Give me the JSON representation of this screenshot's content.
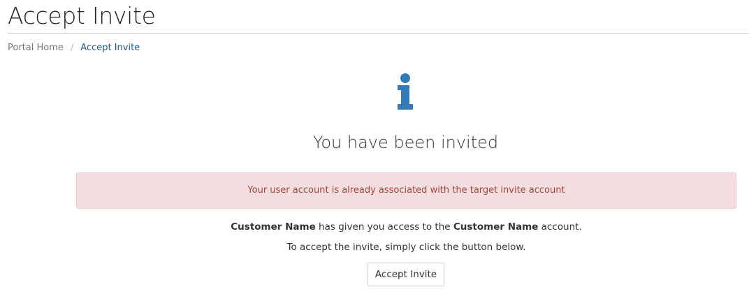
{
  "header": {
    "title": "Accept Invite"
  },
  "breadcrumb": {
    "items": [
      {
        "label": "Portal Home"
      },
      {
        "label": "Accept Invite"
      }
    ],
    "separator": "/"
  },
  "main": {
    "icon": "info-icon",
    "heading": "You have been invited",
    "alert": {
      "type": "danger",
      "text": "Your user account is already associated with the target invite account"
    },
    "message": {
      "inviter": "Customer Name",
      "mid_text": " has given you access to the ",
      "account": "Customer Name",
      "end_text": " account."
    },
    "instruction": "To accept the invite, simply click the button below.",
    "accept_button": "Accept Invite"
  },
  "colors": {
    "accent": "#337ab7",
    "alert_bg": "#f2dede",
    "alert_text": "#a94442",
    "breadcrumb_active": "#1f5a8c"
  }
}
